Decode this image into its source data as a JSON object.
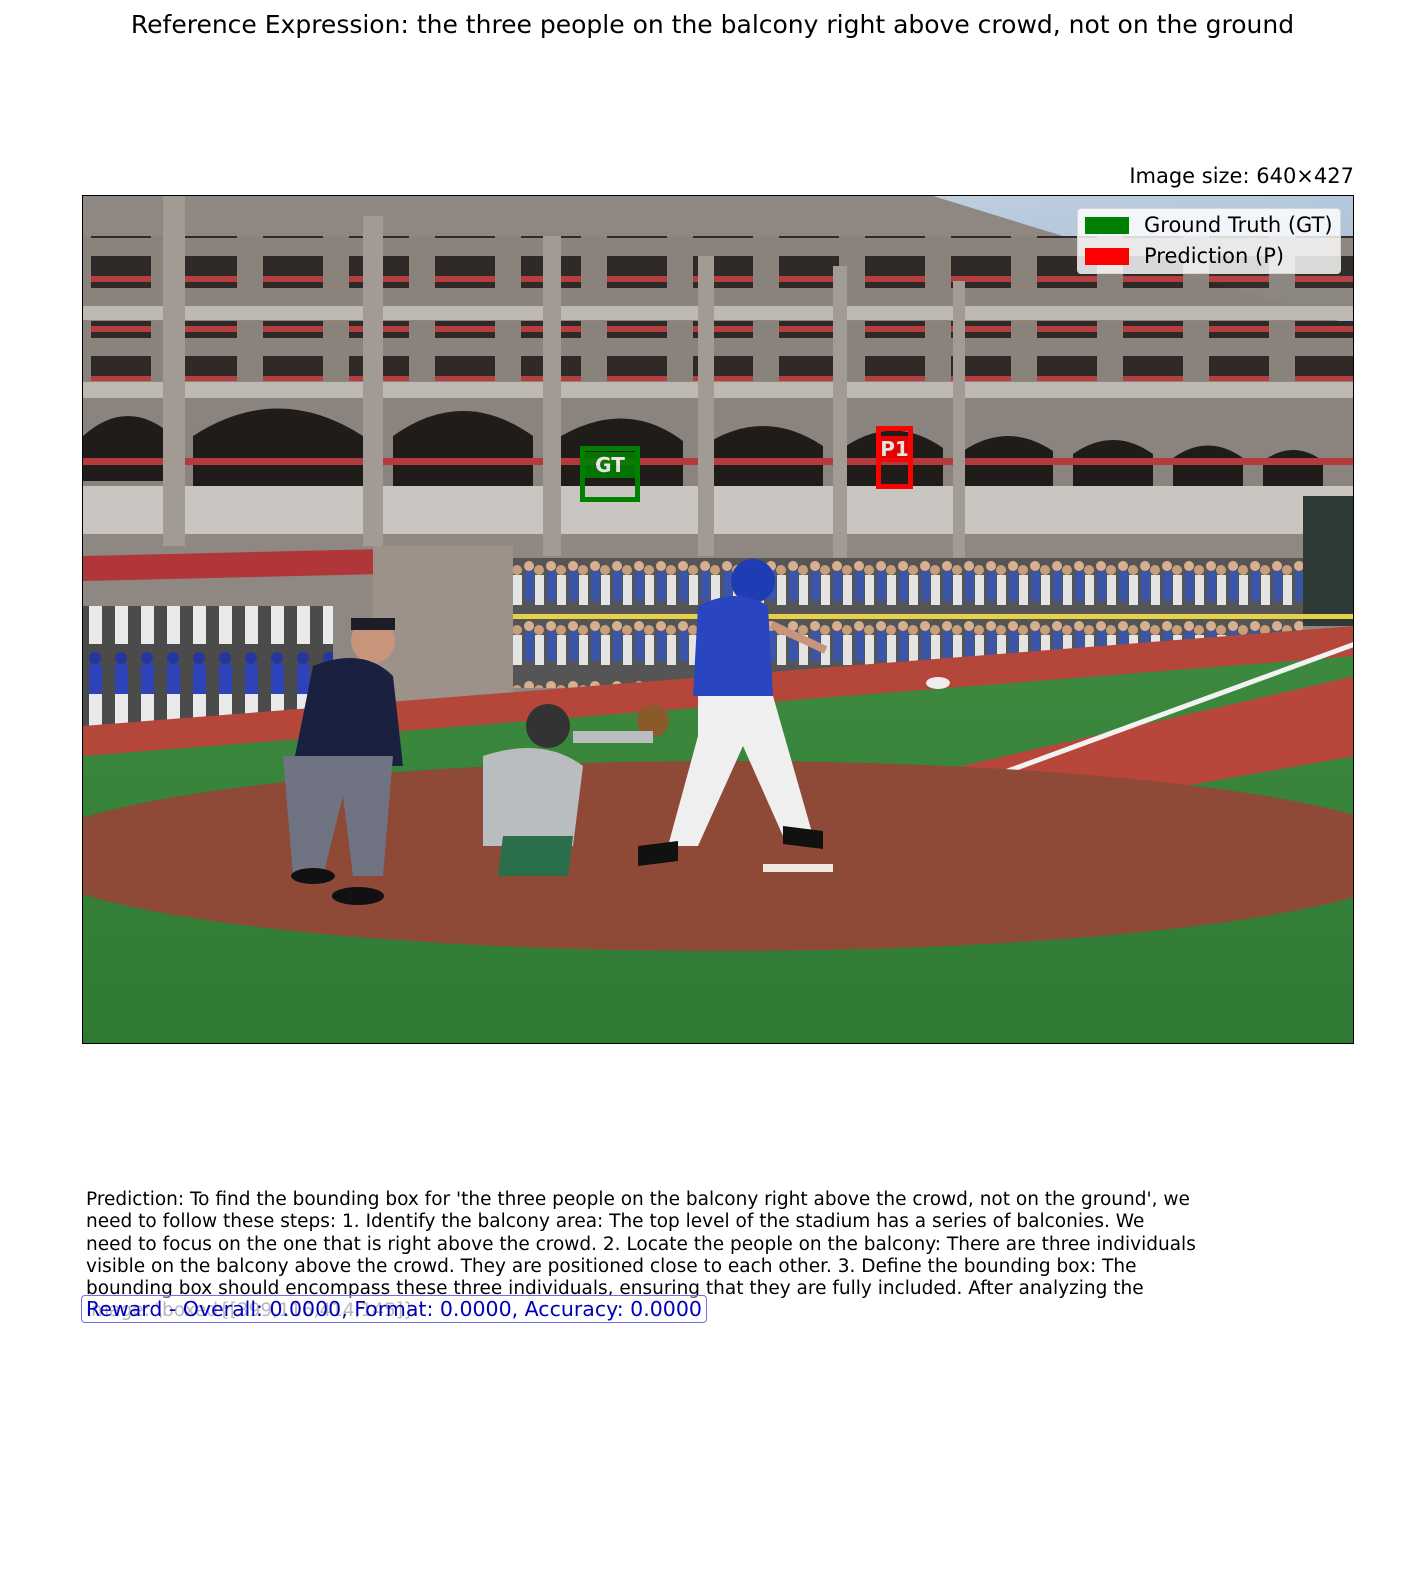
{
  "title": "Reference Expression: the three people on the balcony right above crowd, not on the ground",
  "image_size_text": "Image size: 640×427",
  "image": {
    "description_icon": "baseball-game-photo",
    "ground_truth_box": {
      "label": "GT",
      "color": "#008000"
    },
    "prediction_box": {
      "label": "P1",
      "color": "#ff0000"
    }
  },
  "legend": {
    "items": [
      {
        "label": "Ground Truth (GT)",
        "color": "#008000"
      },
      {
        "label": "Prediction (P)",
        "color": "#ff0000"
      }
    ]
  },
  "prediction_text": {
    "lines": [
      "Prediction: To find the bounding box for 'the three people on the balcony right above the crowd, not on the ground', we",
      "need to follow these steps:  1. Identify the balcony area: The top level of the stadium has a series of balconies. We",
      "need to focus on the one that is right above the crowd. 2. Locate the people on the balcony: There are three individuals",
      "visible on the balcony above the crowd. They are positioned close to each other. 3. Define the bounding box: The",
      "bounding box should encompass these three individuals, ensuring that they are fully included.  After analyzing the",
      "image:  \\boxed{[399,116,414,145]}"
    ]
  },
  "reward_text": "Reward - Overall: 0.0000, Format: 0.0000, Accuracy: 0.0000"
}
